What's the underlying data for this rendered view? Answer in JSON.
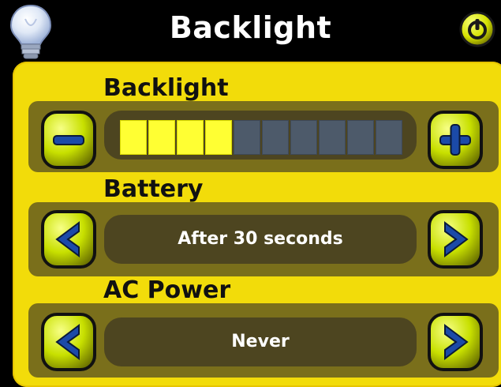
{
  "header": {
    "title": "Backlight",
    "icons": {
      "left": "lightbulb-icon",
      "right": "power-icon"
    }
  },
  "backlight": {
    "label": "Backlight",
    "level": 4,
    "max": 10,
    "colors": {
      "on": "#ffff33",
      "off": "#4d5a6a"
    }
  },
  "battery": {
    "label": "Battery",
    "value": "After 30 seconds"
  },
  "ac_power": {
    "label": "AC Power",
    "value": "Never"
  },
  "theme": {
    "panel": "#f2dc0a",
    "row": "#7a6f1b",
    "track": "#4d4520",
    "button": "#c8e000",
    "accent_blue": "#1b4aa8"
  }
}
